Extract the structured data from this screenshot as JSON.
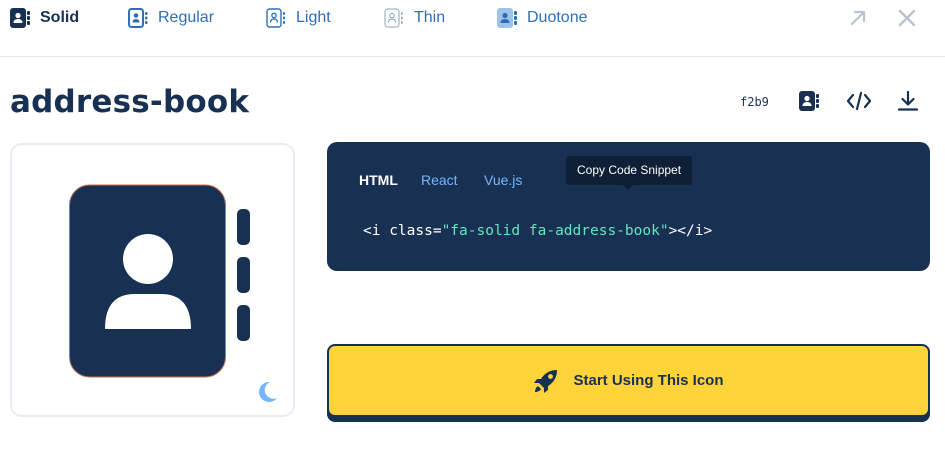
{
  "style_tabs": [
    {
      "label": "Solid",
      "icon": "address-book-solid-icon",
      "active": true
    },
    {
      "label": "Regular",
      "icon": "address-book-regular-icon",
      "active": false
    },
    {
      "label": "Light",
      "icon": "address-book-light-icon",
      "active": false
    },
    {
      "label": "Thin",
      "icon": "address-book-thin-icon",
      "active": false
    },
    {
      "label": "Duotone",
      "icon": "address-book-duotone-icon",
      "active": false
    }
  ],
  "window_controls": {
    "expand_icon": "arrow-up-right-icon",
    "close_icon": "close-icon"
  },
  "icon": {
    "name": "address-book",
    "unicode": "f2b9"
  },
  "actions": {
    "glyph_icon": "address-book-icon",
    "code_icon": "code-icon",
    "download_icon": "download-icon"
  },
  "code_panel": {
    "tabs": [
      {
        "label": "HTML",
        "active": true
      },
      {
        "label": "React",
        "active": false
      },
      {
        "label": "Vue.js",
        "active": false
      }
    ],
    "code": {
      "open": "<i class=",
      "class_value": "\"fa-solid fa-address-book\"",
      "close": "></i>"
    },
    "tooltip": "Copy Code Snippet"
  },
  "preview": {
    "theme_toggle_icon": "moon-icon"
  },
  "cta": {
    "label": "Start Using This Icon",
    "icon": "rocket-icon"
  },
  "colors": {
    "navy": "#183153",
    "blue_link": "#2f6eb5",
    "code_string": "#63e6be",
    "cta_yellow": "#ffd43b",
    "moon": "#73b6ff"
  }
}
